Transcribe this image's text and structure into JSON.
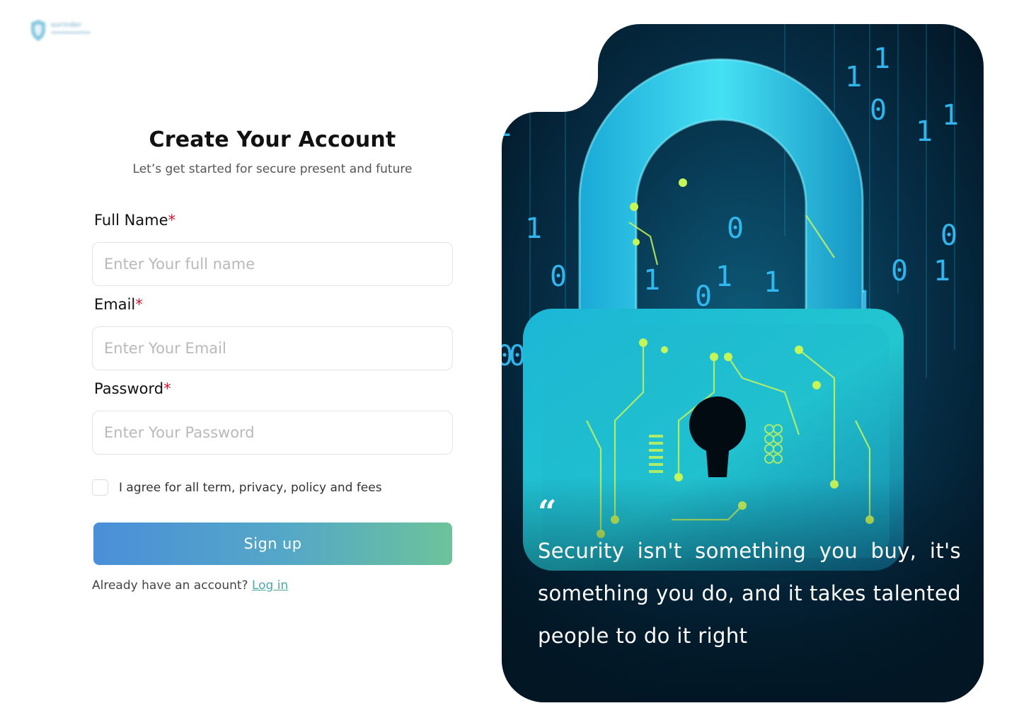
{
  "logo": {
    "text": "surinder"
  },
  "form": {
    "title": "Create Your Account",
    "subtitle": "Let’s get started for secure present and future",
    "fields": [
      {
        "label": "Full Name",
        "required_mark": "*",
        "placeholder": "Enter Your full name",
        "value": ""
      },
      {
        "label": "Email",
        "required_mark": "*",
        "placeholder": "Enter Your Email",
        "value": ""
      },
      {
        "label": "Password",
        "required_mark": "*",
        "placeholder": "Enter Your Password",
        "value": ""
      }
    ],
    "agree_label": "I agree for all term, privacy, policy and fees",
    "agree_checked": false,
    "submit_label": "Sign up",
    "login_prompt": "Already have an account?",
    "login_link": "Log in"
  },
  "hero": {
    "quote_mark": "“",
    "quote": "Security isn't something you buy, it's something you do, and it takes talented people to do it right",
    "binary_digits": [
      "1",
      "1",
      "0",
      "0",
      "1",
      "1",
      "0",
      "0",
      "1",
      "0",
      "1",
      "0",
      "1",
      "0",
      "1",
      "1",
      "0",
      "1",
      "0",
      "1",
      "0"
    ]
  },
  "colors": {
    "accent_start": "#4a8fd9",
    "accent_end": "#6cc39a",
    "required": "#d0142c",
    "link": "#4aa8a5",
    "hero_cyan": "#27c7e8",
    "hero_lime": "#b9f23a"
  }
}
